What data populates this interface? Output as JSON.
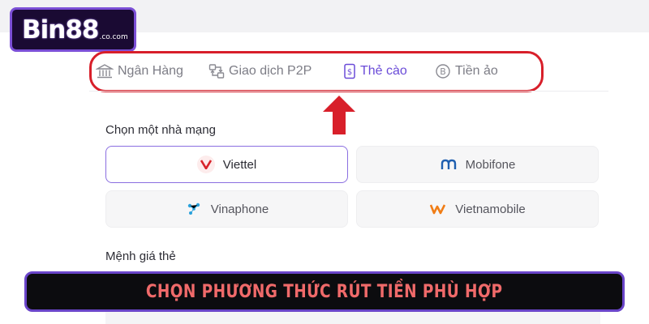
{
  "brand": {
    "name": "Bin88",
    "domain": ".co.com"
  },
  "tabs": [
    {
      "label": "Ngân Hàng",
      "icon": "bank-icon",
      "active": false
    },
    {
      "label": "Giao dịch P2P",
      "icon": "p2p-icon",
      "active": false
    },
    {
      "label": "Thẻ cào",
      "icon": "scratch-card-icon",
      "active": true
    },
    {
      "label": "Tiền ảo",
      "icon": "bitcoin-icon",
      "active": false
    }
  ],
  "carrier_section": {
    "title": "Chọn một nhà mạng",
    "options": [
      {
        "label": "Viettel",
        "selected": true
      },
      {
        "label": "Mobifone",
        "selected": false
      },
      {
        "label": "Vinaphone",
        "selected": false
      },
      {
        "label": "Vietnamobile",
        "selected": false
      }
    ]
  },
  "denomination_section": {
    "title": "Mệnh giá thẻ"
  },
  "banner": {
    "text": "CHỌN PHƯƠNG THỨC RÚT TIỀN PHÙ HỢP"
  },
  "colors": {
    "accent": "#6a4bd8",
    "highlight_frame": "#d81f2a",
    "banner_text": "#f06a6a",
    "viettel_red": "#d8232a",
    "mobifone_blue": "#1f5fb0",
    "vinaphone_blue": "#2aa1db",
    "vietnamobile_orange": "#f07d16"
  }
}
